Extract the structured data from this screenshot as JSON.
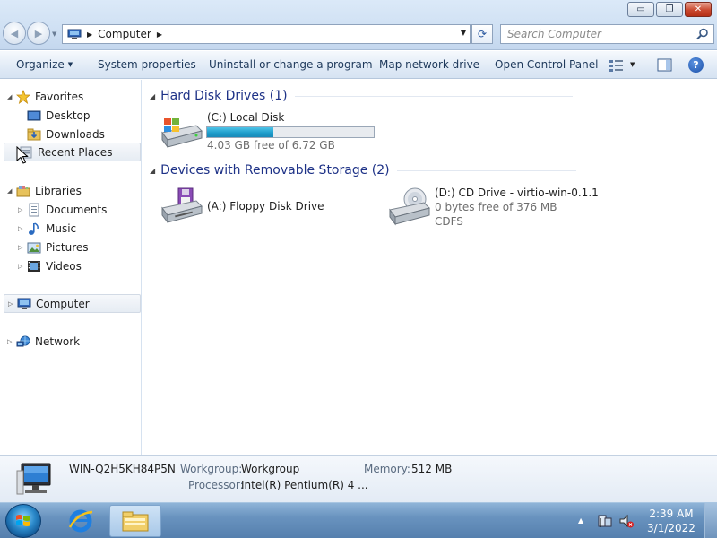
{
  "window": {
    "controls": {
      "minimize": "▭",
      "maximize": "❐",
      "close": "✕"
    }
  },
  "address": {
    "crumb": "Computer",
    "search_placeholder": "Search Computer"
  },
  "commands": {
    "organize": "Organize",
    "system_properties": "System properties",
    "uninstall": "Uninstall or change a program",
    "map_network": "Map network drive",
    "open_control_panel": "Open Control Panel",
    "help": "?"
  },
  "nav": {
    "favorites": "Favorites",
    "desktop": "Desktop",
    "downloads": "Downloads",
    "recent_places": "Recent Places",
    "libraries": "Libraries",
    "documents": "Documents",
    "music": "Music",
    "pictures": "Pictures",
    "videos": "Videos",
    "computer": "Computer",
    "network": "Network"
  },
  "content": {
    "groups": [
      {
        "title": "Hard Disk Drives (1)"
      },
      {
        "title": "Devices with Removable Storage (2)"
      }
    ],
    "drives": [
      {
        "name": "(C:) Local Disk",
        "free_text": "4.03 GB free of 6.72 GB",
        "used_fraction": 0.4,
        "icon": "hard-disk-icon"
      },
      {
        "name": "(A:) Floppy Disk Drive",
        "icon": "floppy-drive-icon"
      },
      {
        "name": "(D:) CD Drive - virtio-win-0.1.1",
        "free_text": "0 bytes free of 376 MB",
        "filesystem": "CDFS",
        "icon": "cd-drive-icon"
      }
    ]
  },
  "details": {
    "computer_name": "WIN-Q2H5KH84P5N",
    "workgroup_label": "Workgroup:",
    "workgroup_value": "Workgroup",
    "memory_label": "Memory:",
    "memory_value": "512 MB",
    "processor_label": "Processor:",
    "processor_value": "Intel(R) Pentium(R) 4   ..."
  },
  "taskbar": {
    "time": "2:39 AM",
    "date": "3/1/2022"
  },
  "colors": {
    "group_title": "#1e3287",
    "disk_bar": "#1d9bc9",
    "taskbar": "#6993bf"
  }
}
